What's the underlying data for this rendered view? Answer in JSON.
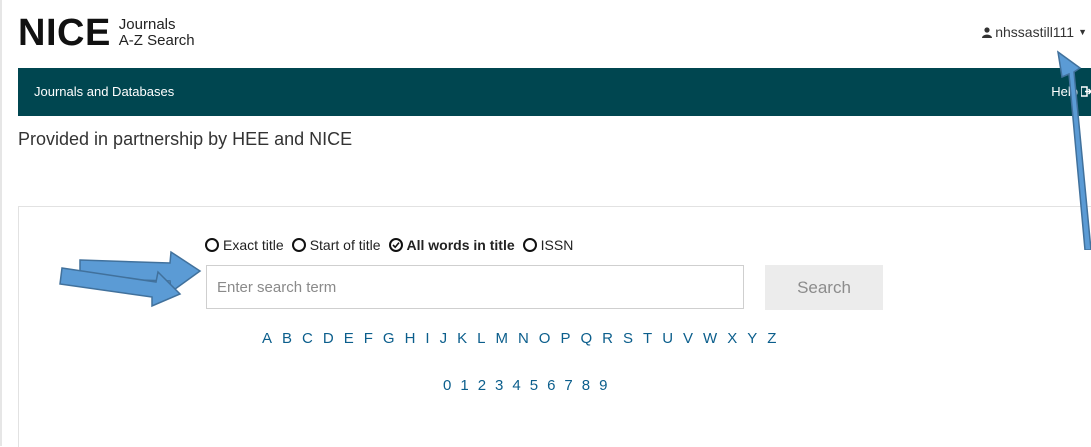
{
  "header": {
    "logo_mark": "NICE",
    "logo_line1": "Journals",
    "logo_line2": "A-Z Search",
    "username": "nhssastill111"
  },
  "nav": {
    "link": "Journals and Databases",
    "help": "Help"
  },
  "partnership_text": "Provided in partnership by HEE and NICE",
  "search": {
    "options": [
      {
        "label": "Exact title",
        "selected": false
      },
      {
        "label": "Start of title",
        "selected": false
      },
      {
        "label": "All words in title",
        "selected": true
      },
      {
        "label": "ISSN",
        "selected": false
      }
    ],
    "placeholder": "Enter search term",
    "value": "",
    "button_label": "Search"
  },
  "letters": [
    "A",
    "B",
    "C",
    "D",
    "E",
    "F",
    "G",
    "H",
    "I",
    "J",
    "K",
    "L",
    "M",
    "N",
    "O",
    "P",
    "Q",
    "R",
    "S",
    "T",
    "U",
    "V",
    "W",
    "X",
    "Y",
    "Z"
  ],
  "digits": [
    "0",
    "1",
    "2",
    "3",
    "4",
    "5",
    "6",
    "7",
    "8",
    "9"
  ],
  "colors": {
    "navbar": "#004650",
    "link": "#0b5e8c",
    "annotation_arrow": "#5b9bd5"
  }
}
